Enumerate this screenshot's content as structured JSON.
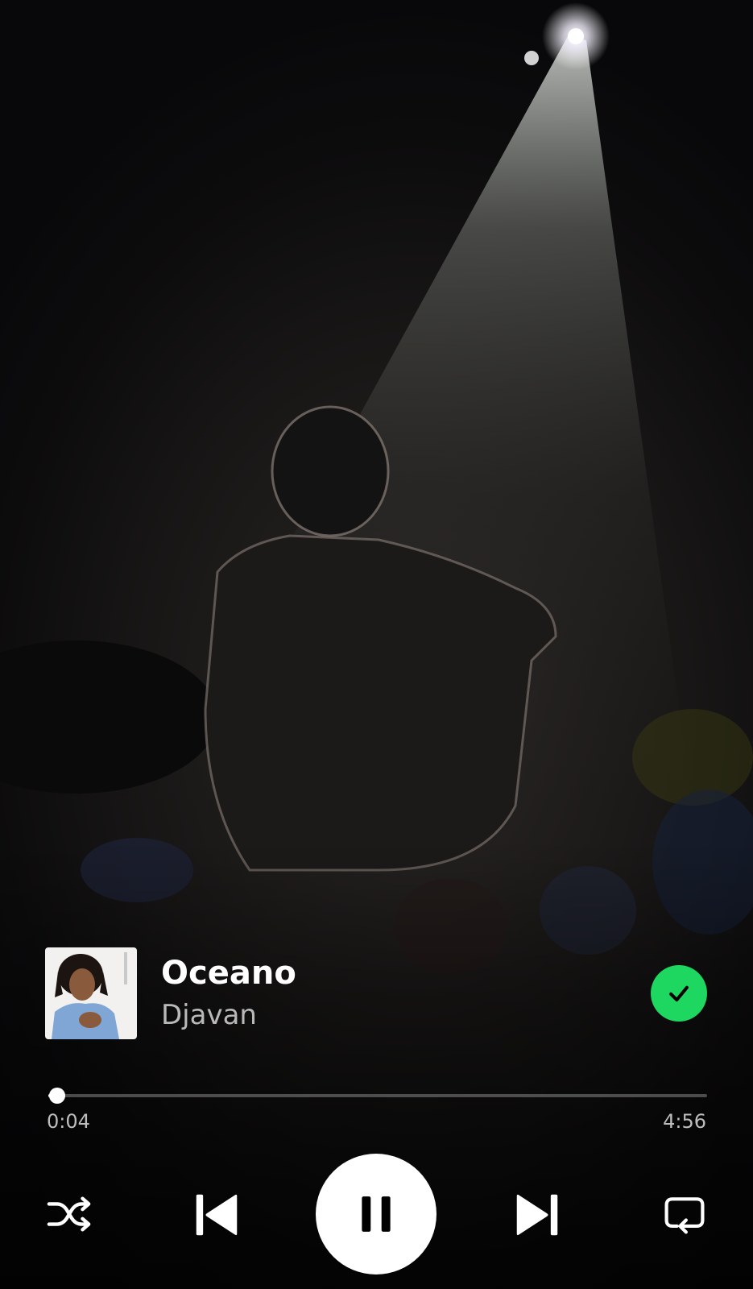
{
  "track": {
    "title": "Oceano",
    "artist": "Djavan",
    "cover_icon": "album-cover-portrait",
    "liked": true
  },
  "playback": {
    "elapsed": "0:04",
    "duration": "4:56",
    "progress_fraction": 0.0135,
    "state": "playing"
  },
  "controls": {
    "shuffle_icon": "shuffle-icon",
    "previous_icon": "skip-previous-icon",
    "play_pause_icon": "pause-icon",
    "next_icon": "skip-next-icon",
    "repeat_icon": "repeat-icon",
    "liked_icon": "check-icon"
  },
  "colors": {
    "accent_green": "#1ed760",
    "text_primary": "#ffffff",
    "text_secondary": "#b9b9b9"
  }
}
